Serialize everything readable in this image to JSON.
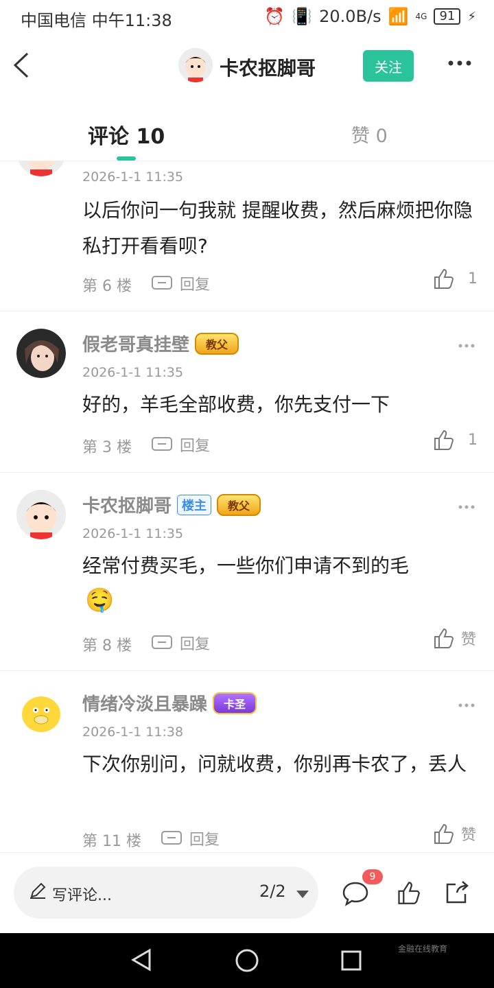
{
  "status_bar": {
    "carrier": "中国电信 中午11:38",
    "speed": "20.0B/s",
    "network": "4G",
    "battery": "91"
  },
  "header": {
    "title": "卡农抠脚哥",
    "follow_label": "关注"
  },
  "tabs": {
    "comments": "评论 10",
    "likes": "赞 0"
  },
  "comments": [
    {
      "username": "",
      "time": "2026-1-1 11:35",
      "text": "以后你问一句我就 提醒收费，然后麻烦把你隐私打开看看呗?",
      "floor": "第 6 楼",
      "reply_label": "回复",
      "like": "1"
    },
    {
      "username": "假老哥真挂壁",
      "badge": "教父",
      "time": "2026-1-1 11:35",
      "text": "好的，羊毛全部收费，你先支付一下",
      "floor": "第 3 楼",
      "reply_label": "回复",
      "like": "1"
    },
    {
      "username": "卡农抠脚哥",
      "host_badge": "楼主",
      "badge": "教父",
      "time": "2026-1-1 11:35",
      "text": "经常付费买毛，一些你们申请不到的毛",
      "emoji": "🤤",
      "floor": "第 8 楼",
      "reply_label": "回复",
      "like": "赞"
    },
    {
      "username": "情绪冷淡且暴躁",
      "badge": "卡圣",
      "time": "2026-1-1 11:38",
      "text": "下次你别问，问就收费，你别再卡农了，丢人",
      "floor": "第 11 楼",
      "reply_label": "回复",
      "like": "赞"
    }
  ],
  "bottom_bar": {
    "write_placeholder": "写评论...",
    "page_indicator": "2/2",
    "comment_count_badge": "9"
  },
  "watermark": "金融在线教育",
  "colors": {
    "accent": "#2bc39a",
    "badge_red": "#f25b5b",
    "host_blue": "#3a8ee6"
  }
}
